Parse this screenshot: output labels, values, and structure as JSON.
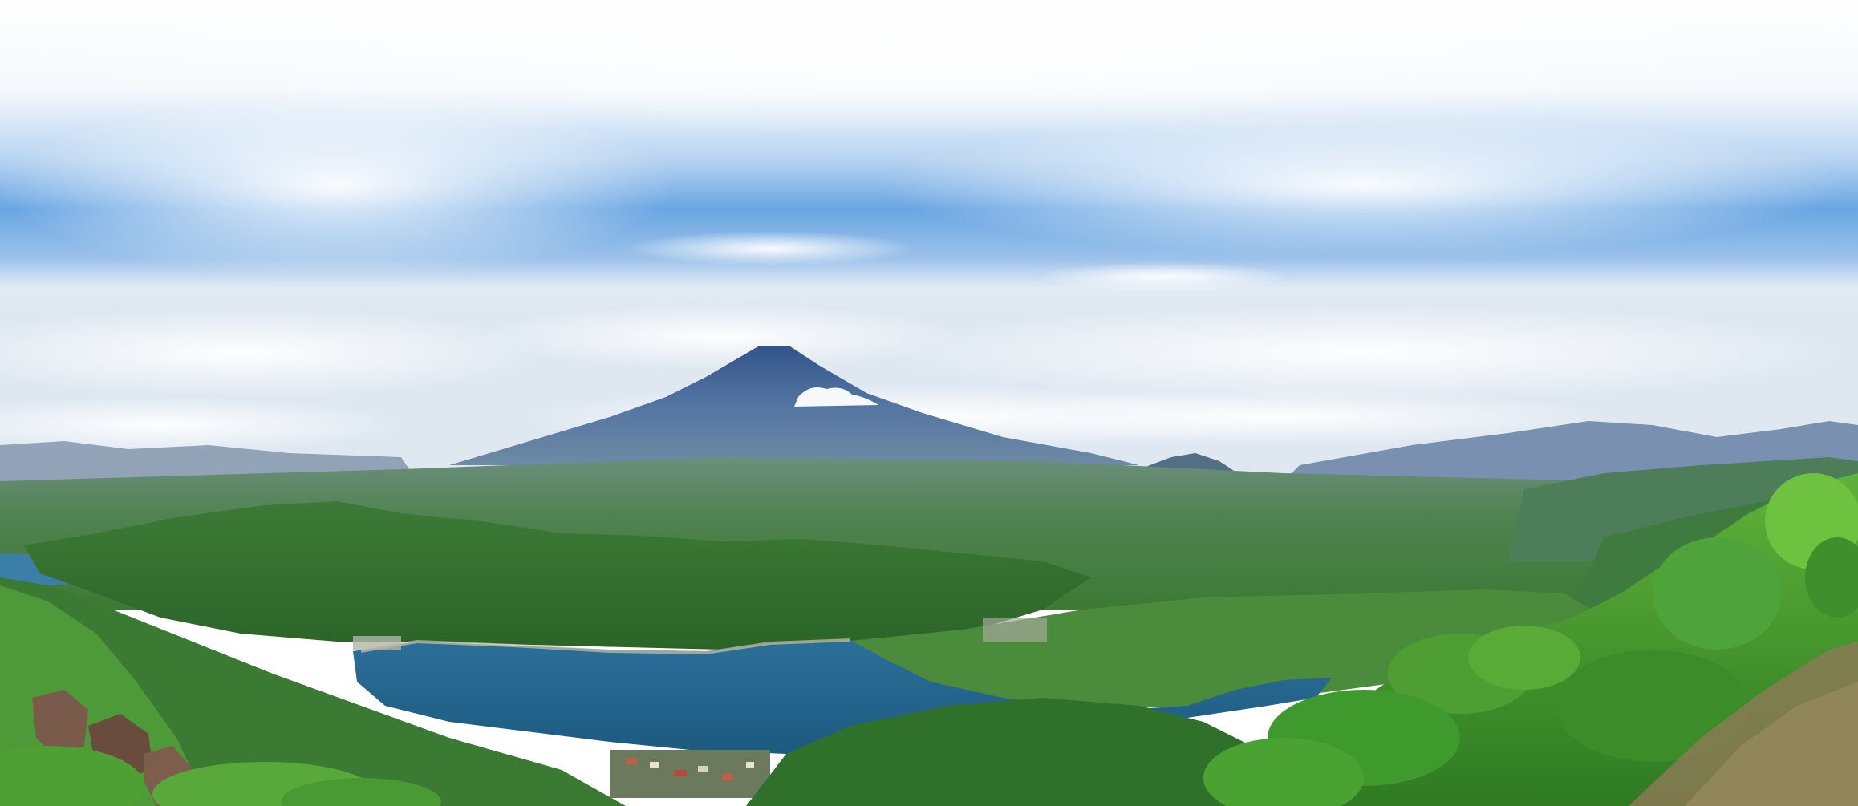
{
  "scene": {
    "description_visible_text": "",
    "colors": {
      "sky_top": "#ffffff",
      "sky_mid": "#cfe3f6",
      "sky_blue": "#5b9fe0",
      "sky_horizon": "#e9eff6",
      "distant_mountain": "#7d93b3",
      "fuji_peak": "#3d5f93",
      "fuji_base": "#6b86a6",
      "far_forest": "#5e8a5e",
      "mid_forest": "#3f7a3a",
      "near_ridge": "#2f6b2c",
      "lake_deep": "#1f5f86",
      "lake_light": "#2f77a0",
      "foreground_pine": "#3f9a2e",
      "foreground_bright": "#6ec23f",
      "rock": "#7a5a4a",
      "slope_brown": "#8a7a55"
    }
  }
}
